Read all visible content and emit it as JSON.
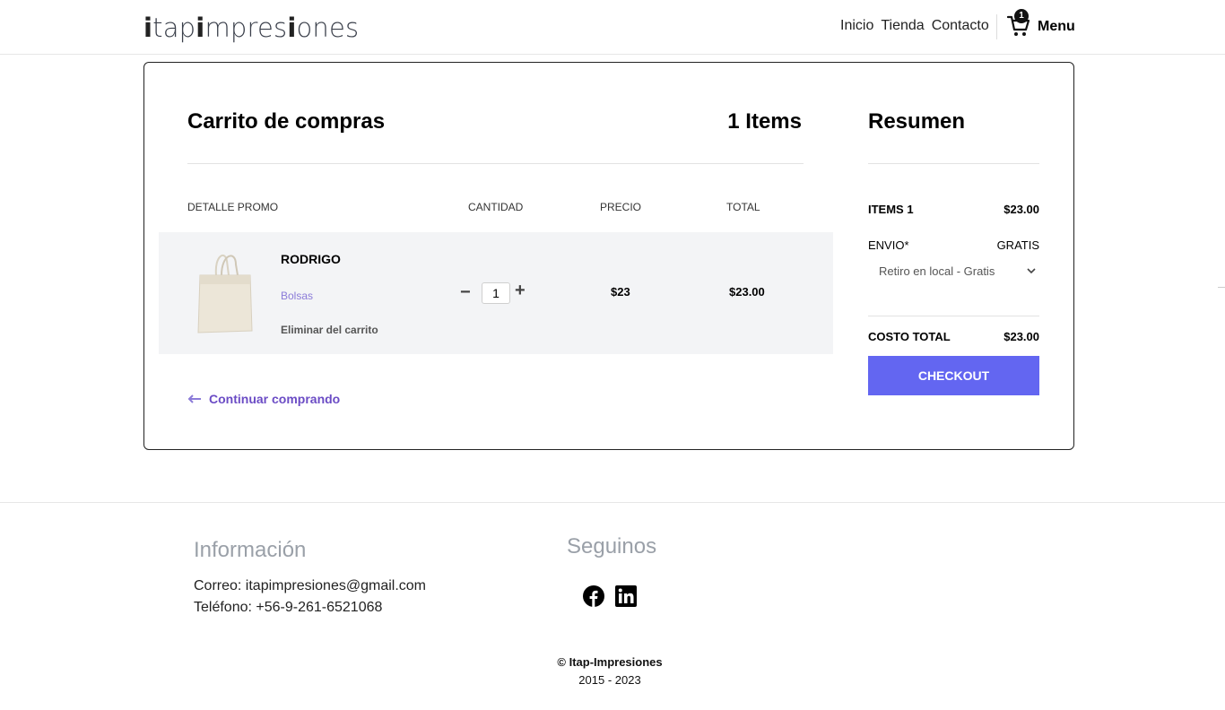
{
  "header": {
    "logo_parts": [
      "i",
      "tap",
      "i",
      "mpres",
      "i",
      "ones"
    ],
    "nav": [
      "Inicio",
      "Tienda",
      "Contacto"
    ],
    "cart_count": "1",
    "menu_label": "Menu"
  },
  "cart": {
    "title": "Carrito de compras",
    "items_count": "1 Items",
    "columns": [
      "DETALLE PROMO",
      "CANTIDAD",
      "PRECIO",
      "TOTAL"
    ],
    "item": {
      "name": "RODRIGO",
      "category": "Bolsas",
      "remove_label": "Eliminar del carrito",
      "quantity": "1",
      "price": "$23",
      "total": "$23.00"
    },
    "continue_label": "Continuar comprando"
  },
  "summary": {
    "title": "Resumen",
    "items_label": "ITEMS 1",
    "items_value": "$23.00",
    "shipping_label": "ENVIO*",
    "shipping_value": "GRATIS",
    "shipping_option": "Retiro en local - Gratis",
    "total_label": "COSTO TOTAL",
    "total_value": "$23.00",
    "checkout_label": "CHECKOUT"
  },
  "footer": {
    "info_title": "Información",
    "email_line": "Correo: itapimpresiones@gmail.com",
    "phone_line": "Teléfono: +56-9-261-6521068",
    "follow_title": "Seguinos",
    "social_icons": [
      "facebook-icon",
      "linkedin-icon"
    ],
    "copyright": "© Itap-Impresiones",
    "years": "2015 - 2023"
  },
  "colors": {
    "accent": "#6366f1",
    "link": "#6b4cc5",
    "category": "#8b7bd8",
    "row_bg": "#f3f4f6"
  }
}
